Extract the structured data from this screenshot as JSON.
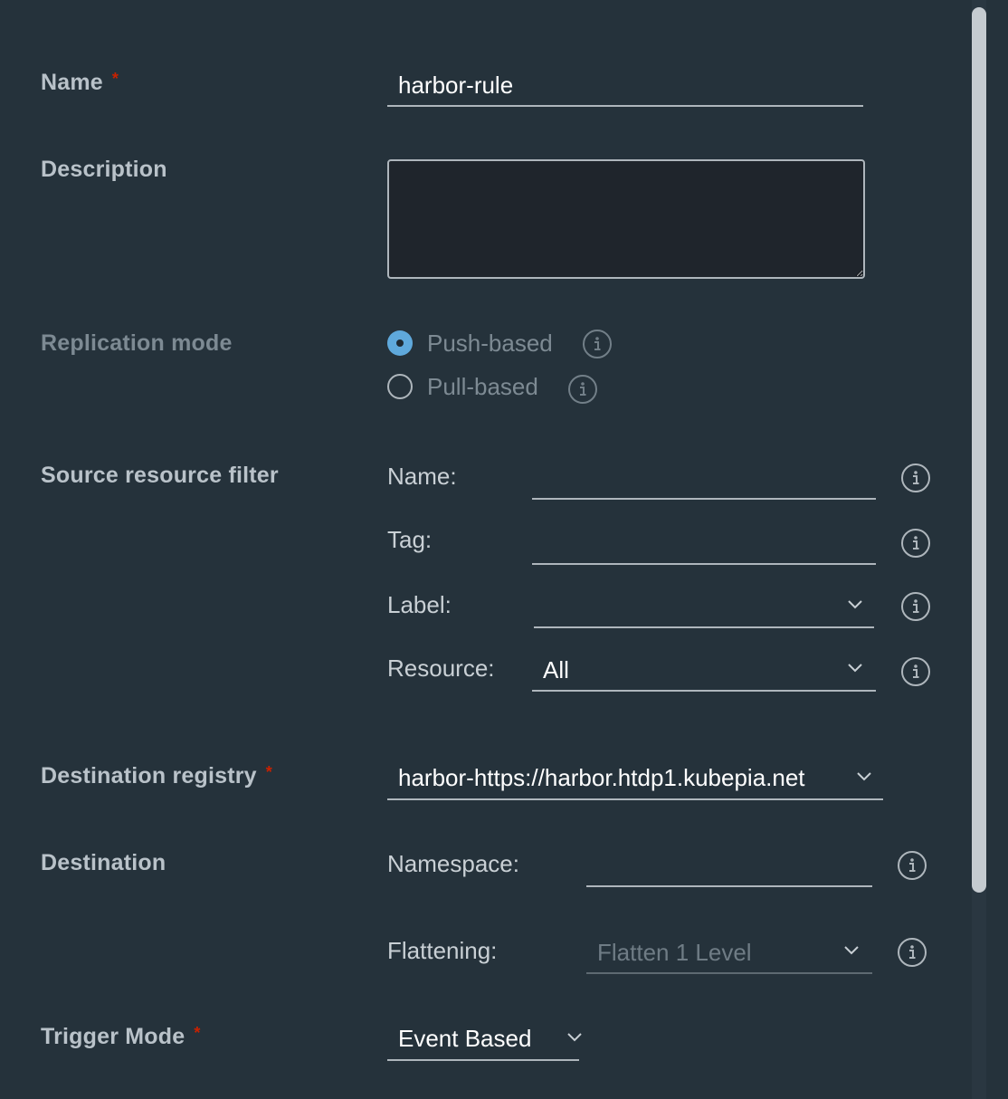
{
  "form": {
    "name": {
      "label": "Name",
      "required_mark": "*",
      "value": "harbor-rule"
    },
    "description": {
      "label": "Description",
      "value": ""
    },
    "replication_mode": {
      "label": "Replication mode",
      "options": [
        {
          "label": "Push-based",
          "selected": true
        },
        {
          "label": "Pull-based",
          "selected": false
        }
      ]
    },
    "source_filter": {
      "label": "Source resource filter",
      "name_label": "Name:",
      "name_value": "",
      "tag_label": "Tag:",
      "tag_value": "",
      "label_label": "Label:",
      "label_value": "",
      "resource_label": "Resource:",
      "resource_value": "All"
    },
    "destination_registry": {
      "label": "Destination registry",
      "required_mark": "*",
      "value": "harbor-https://harbor.htdp1.kubepia.net"
    },
    "destination": {
      "label": "Destination",
      "namespace_label": "Namespace:",
      "namespace_value": "",
      "flattening_label": "Flattening:",
      "flattening_value": "Flatten 1 Level"
    },
    "trigger_mode": {
      "label": "Trigger Mode",
      "required_mark": "*",
      "value": "Event Based"
    }
  },
  "icons": {
    "info": "info-icon",
    "dropdown": "chevron-down-icon",
    "radio": "radio-icon"
  },
  "colors": {
    "background": "#25323b",
    "accent": "#5fa9dc",
    "required": "#c92100",
    "textarea_bg": "#1f252c"
  }
}
